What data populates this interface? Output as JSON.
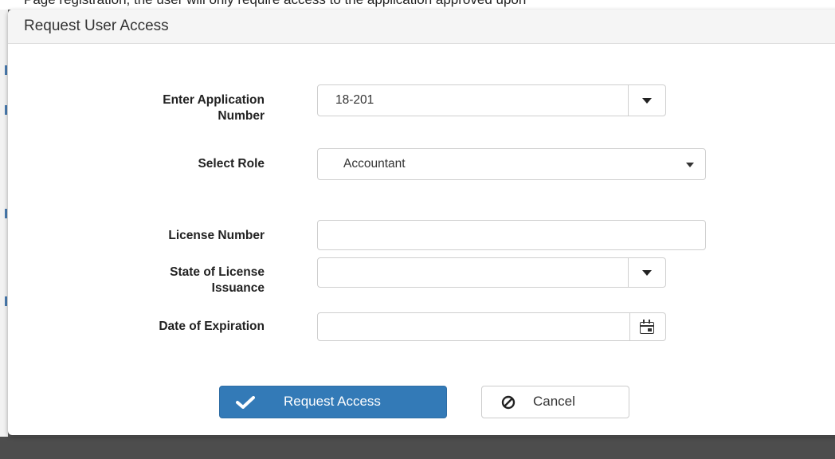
{
  "background": {
    "page_text": "Page registration, the user will only require access to the application approved upon"
  },
  "modal": {
    "title": "Request User Access"
  },
  "form": {
    "application_number": {
      "label_line1": "Enter Application",
      "label_line2": "Number",
      "value": "18-201"
    },
    "role": {
      "label": "Select Role",
      "value": "Accountant"
    },
    "license_number": {
      "label": "License Number",
      "value": ""
    },
    "license_state": {
      "label_line1": "State of License",
      "label_line2": "Issuance",
      "value": ""
    },
    "expiration_date": {
      "label": "Date of Expiration",
      "value": ""
    }
  },
  "buttons": {
    "request_access": "Request Access",
    "cancel": "Cancel"
  },
  "colors": {
    "primary": "#337ab7",
    "header_bg": "#f5f5f5",
    "overlay": "#5a5a5a"
  },
  "icons": {
    "dropdown": "chevron-down-icon",
    "calendar": "calendar-icon",
    "check": "check-icon",
    "cancel": "ban-icon"
  }
}
